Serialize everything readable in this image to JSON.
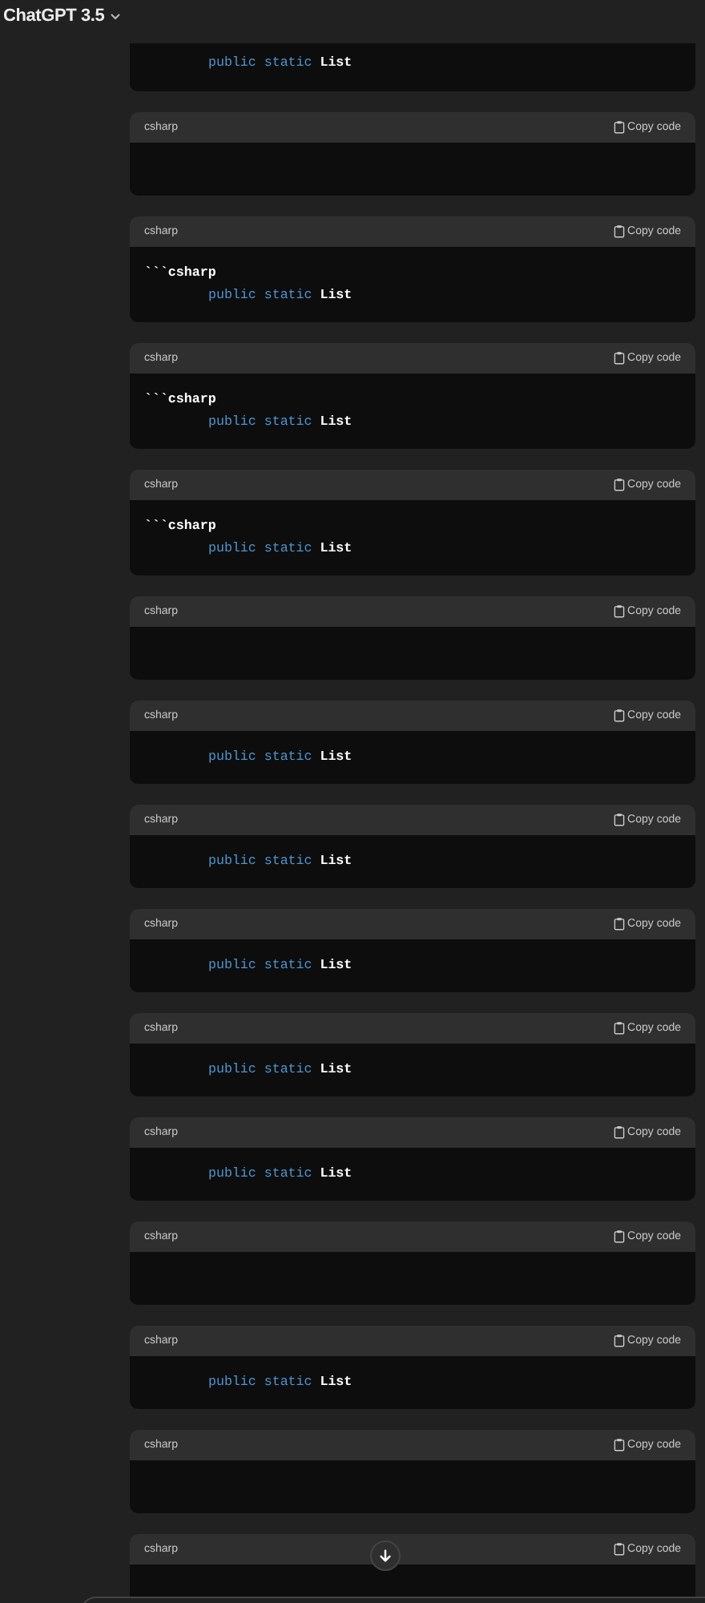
{
  "header": {
    "title": "ChatGPT 3.5"
  },
  "code_blocks": [
    {
      "lines": [
        {
          "indented": true,
          "tokens": [
            {
              "text": "public",
              "kind": "keyword"
            },
            {
              "text": "static",
              "kind": "keyword"
            },
            {
              "text": "List",
              "kind": "plain"
            }
          ]
        }
      ]
    },
    {
      "language": "csharp",
      "copy_label": "Copy code"
    },
    {
      "language": "csharp",
      "copy_label": "Copy code",
      "lines": [
        {
          "indented": false,
          "tokens": [
            {
              "text": "```csharp",
              "kind": "plain"
            }
          ]
        },
        {
          "indented": true,
          "tokens": [
            {
              "text": "public",
              "kind": "keyword"
            },
            {
              "text": "static",
              "kind": "keyword"
            },
            {
              "text": "List",
              "kind": "plain"
            }
          ]
        }
      ]
    },
    {
      "language": "csharp",
      "copy_label": "Copy code",
      "lines": [
        {
          "indented": false,
          "tokens": [
            {
              "text": "```csharp",
              "kind": "plain"
            }
          ]
        },
        {
          "indented": true,
          "tokens": [
            {
              "text": "public",
              "kind": "keyword"
            },
            {
              "text": "static",
              "kind": "keyword"
            },
            {
              "text": "List",
              "kind": "plain"
            }
          ]
        }
      ]
    },
    {
      "language": "csharp",
      "copy_label": "Copy code",
      "lines": [
        {
          "indented": false,
          "tokens": [
            {
              "text": "```csharp",
              "kind": "plain"
            }
          ]
        },
        {
          "indented": true,
          "tokens": [
            {
              "text": "public",
              "kind": "keyword"
            },
            {
              "text": "static",
              "kind": "keyword"
            },
            {
              "text": "List",
              "kind": "plain"
            }
          ]
        }
      ]
    },
    {
      "language": "csharp",
      "copy_label": "Copy code"
    },
    {
      "language": "csharp",
      "copy_label": "Copy code",
      "lines": [
        {
          "indented": true,
          "tokens": [
            {
              "text": "public",
              "kind": "keyword"
            },
            {
              "text": "static",
              "kind": "keyword"
            },
            {
              "text": "List",
              "kind": "plain"
            }
          ]
        }
      ]
    },
    {
      "language": "csharp",
      "copy_label": "Copy code",
      "lines": [
        {
          "indented": true,
          "tokens": [
            {
              "text": "public",
              "kind": "keyword"
            },
            {
              "text": "static",
              "kind": "keyword"
            },
            {
              "text": "List",
              "kind": "plain"
            }
          ]
        }
      ]
    },
    {
      "language": "csharp",
      "copy_label": "Copy code",
      "lines": [
        {
          "indented": true,
          "tokens": [
            {
              "text": "public",
              "kind": "keyword"
            },
            {
              "text": "static",
              "kind": "keyword"
            },
            {
              "text": "List",
              "kind": "plain"
            }
          ]
        }
      ]
    },
    {
      "language": "csharp",
      "copy_label": "Copy code",
      "lines": [
        {
          "indented": true,
          "tokens": [
            {
              "text": "public",
              "kind": "keyword"
            },
            {
              "text": "static",
              "kind": "keyword"
            },
            {
              "text": "List",
              "kind": "plain"
            }
          ]
        }
      ]
    },
    {
      "language": "csharp",
      "copy_label": "Copy code",
      "lines": [
        {
          "indented": true,
          "tokens": [
            {
              "text": "public",
              "kind": "keyword"
            },
            {
              "text": "static",
              "kind": "keyword"
            },
            {
              "text": "List",
              "kind": "plain"
            }
          ]
        }
      ]
    },
    {
      "language": "csharp",
      "copy_label": "Copy code"
    },
    {
      "language": "csharp",
      "copy_label": "Copy code",
      "lines": [
        {
          "indented": true,
          "tokens": [
            {
              "text": "public",
              "kind": "keyword"
            },
            {
              "text": "static",
              "kind": "keyword"
            },
            {
              "text": "List",
              "kind": "plain"
            }
          ]
        }
      ]
    },
    {
      "language": "csharp",
      "copy_label": "Copy code"
    },
    {
      "language": "csharp",
      "copy_label": "Copy code"
    }
  ]
}
